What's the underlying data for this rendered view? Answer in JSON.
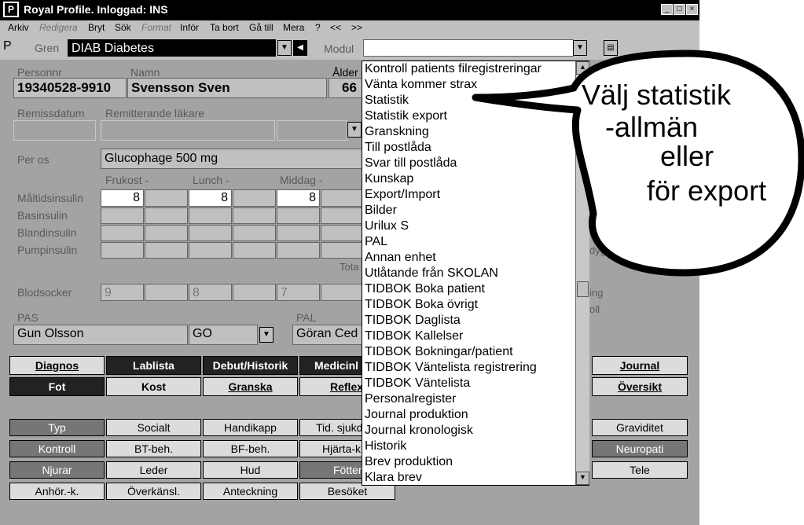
{
  "window": {
    "logo": "P",
    "title": "Royal Profile. Inloggad:  INS"
  },
  "menu": [
    "Arkiv",
    "Redigera",
    "Bryt",
    "Sök",
    "Format",
    "Infór",
    "Ta bort",
    "Gå till",
    "Mera",
    "?",
    "<<",
    ">>"
  ],
  "toolbar": {
    "left_letter": "P",
    "gren_label": "Gren",
    "gren_value": "DIAB Diabetes",
    "modul_label": "Modul",
    "modul_value": ""
  },
  "patient": {
    "personnr_label": "Personnr",
    "namn_label": "Namn",
    "alder_label": "Ålder",
    "personnr": "19340528-9910",
    "namn": "Svensson Sven",
    "alder": "66"
  },
  "remiss": {
    "datum_label": "Remissdatum",
    "lakare_label": "Remitterande läkare"
  },
  "medication": {
    "per_os_label": "Per os",
    "per_os_value": "Glucophage 500 mg",
    "col_frukost": "Frukost  -",
    "col_lunch": "Lunch    -",
    "col_middag": "Middag  -",
    "rows": [
      "Måltidsinsulin",
      "Basinsulin",
      "Blandinsulin",
      "Pumpinsulin"
    ],
    "maltid_frukost": "8",
    "maltid_lunch": "8",
    "maltid_middag": "8",
    "totalt_label": "Tota",
    "dygn_label": "dygn"
  },
  "blodsocker": {
    "label": "Blodsocker",
    "v1": "9",
    "v2": "8",
    "v3": "7",
    "side1": "ing",
    "side2": "oll"
  },
  "pas": {
    "pas_label": "PAS",
    "pas_name": "Gun Olsson",
    "pas_code": "GO",
    "pal_label": "PAL",
    "pal_name": "Göran Ced"
  },
  "buttons_row1": [
    "Diagnos",
    "Lablista",
    "Debut/Historik",
    "Medicinl",
    "Journal"
  ],
  "buttons_row2": [
    "Fot",
    "Kost",
    "Granska",
    "Reflex",
    "Översikt"
  ],
  "buttons_row3": [
    "Typ",
    "Socialt",
    "Handikapp",
    "Tid. sjukd",
    "Graviditet"
  ],
  "buttons_row4": [
    "Kontroll",
    "BT-beh.",
    "BF-beh.",
    "Hjärta-k",
    "Neuropati"
  ],
  "buttons_row5": [
    "Njurar",
    "Leder",
    "Hud",
    "Fötter",
    "Tele"
  ],
  "buttons_row6": [
    "Anhör.-k.",
    "Överkänsl.",
    "Anteckning",
    "Besöket"
  ],
  "dropdown_items": [
    "Kontroll patients filregistreringar",
    "Vänta kommer strax",
    "Statistik",
    "Statistik export",
    "Granskning",
    "Till postlåda",
    "Svar till postlåda",
    "Kunskap",
    "Export/Import",
    "Bilder",
    "Urilux S",
    "PAL",
    "Annan enhet",
    "Utlåtande från SKOLAN",
    "TIDBOK Boka patient",
    "TIDBOK Boka övrigt",
    "TIDBOK Daglista",
    "TIDBOK Kallelser",
    "TIDBOK Bokningar/patient",
    "TIDBOK Väntelista registrering",
    "TIDBOK Väntelista",
    "Personalregister",
    "Journal produktion",
    "Journal kronologisk",
    "Historik",
    "Brev produktion",
    "Klara brev"
  ],
  "callout": {
    "line1": "Välj statistik",
    "line2": "-allmän",
    "line3": "eller",
    "line4": "för export"
  }
}
